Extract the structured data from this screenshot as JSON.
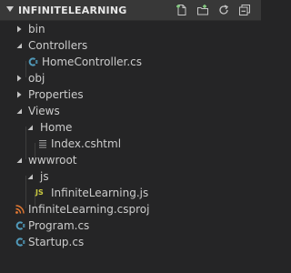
{
  "header": {
    "title": "INFINITELEARNING",
    "actions": [
      {
        "icon": "new-file-icon"
      },
      {
        "icon": "new-folder-icon"
      },
      {
        "icon": "refresh-icon"
      },
      {
        "icon": "collapse-all-icon"
      }
    ]
  },
  "tree": [
    {
      "label": "bin",
      "type": "folder",
      "expanded": false
    },
    {
      "label": "Controllers",
      "type": "folder",
      "expanded": true
    },
    {
      "label": "HomeController.cs",
      "type": "file",
      "icon": "csharp-file-icon"
    },
    {
      "label": "obj",
      "type": "folder",
      "expanded": false
    },
    {
      "label": "Properties",
      "type": "folder",
      "expanded": false
    },
    {
      "label": "Views",
      "type": "folder",
      "expanded": true
    },
    {
      "label": "Home",
      "type": "folder",
      "expanded": true
    },
    {
      "label": "Index.cshtml",
      "type": "file",
      "icon": "cshtml-file-icon"
    },
    {
      "label": "wwwroot",
      "type": "folder",
      "expanded": true
    },
    {
      "label": "js",
      "type": "folder",
      "expanded": true
    },
    {
      "label": "InfiniteLearning.js",
      "type": "file",
      "icon": "js-file-icon",
      "badge": "JS"
    },
    {
      "label": "InfiniteLearning.csproj",
      "type": "file",
      "icon": "csproj-file-icon"
    },
    {
      "label": "Program.cs",
      "type": "file",
      "icon": "csharp-file-icon"
    },
    {
      "label": "Startup.cs",
      "type": "file",
      "icon": "csharp-file-icon"
    }
  ],
  "colors": {
    "background": "#252526",
    "header": "#383838",
    "text": "#cccccc",
    "csharp": "#519aba",
    "javascript": "#cbcb41",
    "csproj": "#e37933"
  }
}
